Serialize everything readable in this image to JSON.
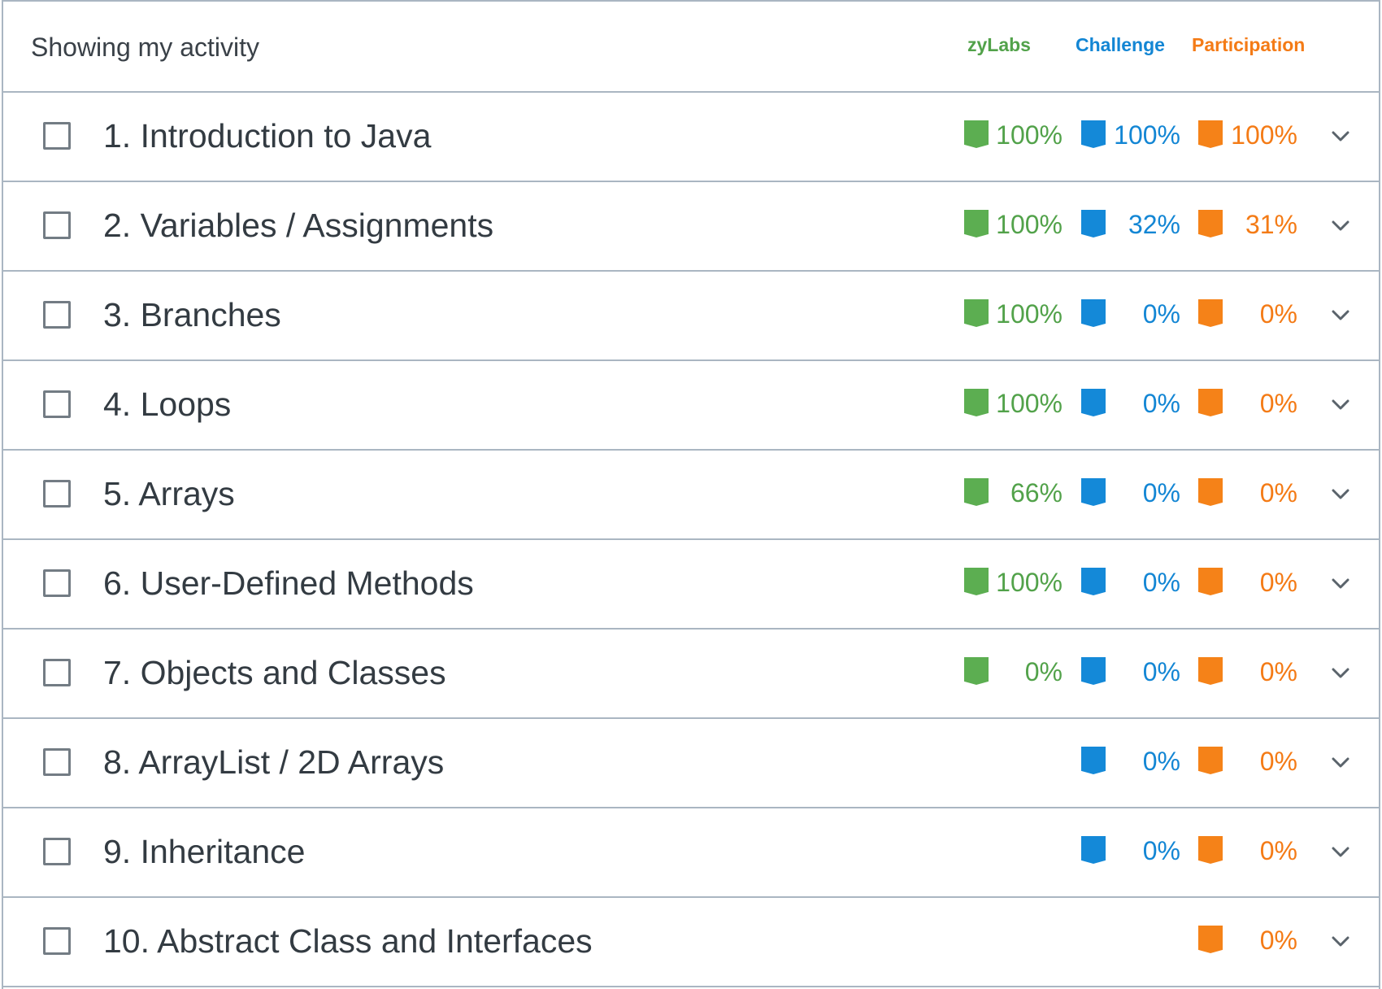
{
  "header": {
    "title": "Showing my activity",
    "zylabs_label": "zyLabs",
    "challenge_label": "Challenge",
    "participation_label": "Participation"
  },
  "colors": {
    "zylabs": "#5cae51",
    "challenge": "#1489d8",
    "participation": "#f58218",
    "border": "#aab6c2"
  },
  "chapters": [
    {
      "title": "1. Introduction to Java",
      "zylabs": "100%",
      "challenge": "100%",
      "participation": "100%"
    },
    {
      "title": "2. Variables / Assignments",
      "zylabs": "100%",
      "challenge": "32%",
      "participation": "31%"
    },
    {
      "title": "3. Branches",
      "zylabs": "100%",
      "challenge": "0%",
      "participation": "0%"
    },
    {
      "title": "4. Loops",
      "zylabs": "100%",
      "challenge": "0%",
      "participation": "0%"
    },
    {
      "title": "5. Arrays",
      "zylabs": "66%",
      "challenge": "0%",
      "participation": "0%"
    },
    {
      "title": "6. User-Defined Methods",
      "zylabs": "100%",
      "challenge": "0%",
      "participation": "0%"
    },
    {
      "title": "7. Objects and Classes",
      "zylabs": "0%",
      "challenge": "0%",
      "participation": "0%"
    },
    {
      "title": "8. ArrayList / 2D Arrays",
      "zylabs": null,
      "challenge": "0%",
      "participation": "0%"
    },
    {
      "title": "9. Inheritance",
      "zylabs": null,
      "challenge": "0%",
      "participation": "0%"
    },
    {
      "title": "10. Abstract Class and Interfaces",
      "zylabs": null,
      "challenge": null,
      "participation": "0%"
    }
  ]
}
